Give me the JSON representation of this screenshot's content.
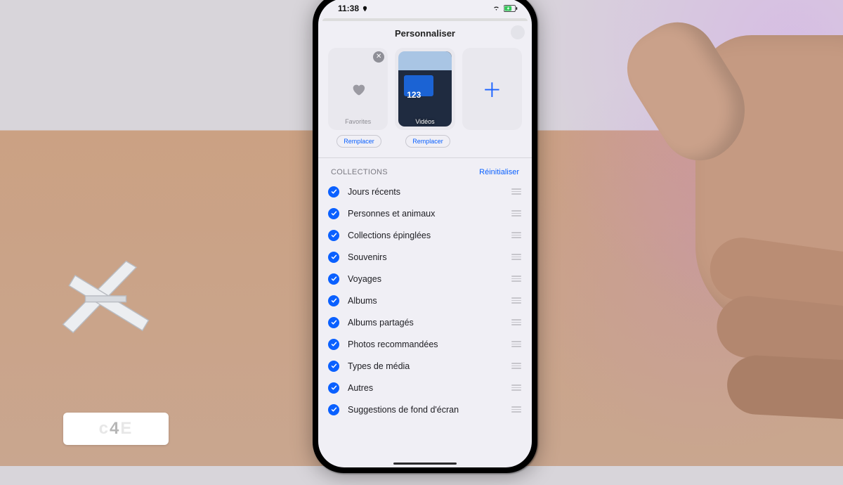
{
  "status": {
    "time": "11:38"
  },
  "header": {
    "title": "Personnaliser"
  },
  "tiles": {
    "favorites_label": "Favorites",
    "videos_label": "Vidéos",
    "replace_label": "Remplacer"
  },
  "collections": {
    "section_title": "COLLECTIONS",
    "reset_label": "Réinitialiser",
    "items": [
      {
        "label": "Jours récents"
      },
      {
        "label": "Personnes et animaux"
      },
      {
        "label": "Collections épinglées"
      },
      {
        "label": "Souvenirs"
      },
      {
        "label": "Voyages"
      },
      {
        "label": "Albums"
      },
      {
        "label": "Albums partagés"
      },
      {
        "label": "Photos recommandées"
      },
      {
        "label": "Types de média"
      },
      {
        "label": "Autres"
      },
      {
        "label": "Suggestions de fond d'écran"
      }
    ]
  },
  "watermark": {
    "left": "c",
    "mid": "4",
    "right": "E"
  }
}
